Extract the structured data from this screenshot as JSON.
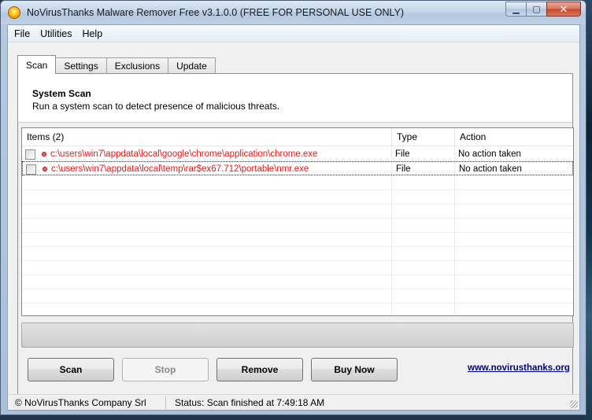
{
  "window": {
    "title": "NoVirusThanks Malware Remover Free v3.1.0.0 (FREE FOR PERSONAL USE ONLY)",
    "min_glyph": "▁",
    "max_glyph": "▢",
    "close_glyph": "✕"
  },
  "menu": {
    "items": [
      "File",
      "Utilities",
      "Help"
    ]
  },
  "tabs": {
    "items": [
      "Scan",
      "Settings",
      "Exclusions",
      "Update"
    ],
    "active": "Scan"
  },
  "panel": {
    "title": "System Scan",
    "subtitle": "Run a system scan to detect presence of malicious threats."
  },
  "list": {
    "columns": [
      "Items (2)",
      "Type",
      "Action"
    ],
    "rows": [
      {
        "path": "c:\\users\\win7\\appdata\\local\\google\\chrome\\application\\chrome.exe",
        "type": "File",
        "action": "No action taken",
        "checked": false
      },
      {
        "path": "c:\\users\\win7\\appdata\\local\\temp\\rar$ex67.712\\portable\\nmr.exe",
        "type": "File",
        "action": "No action taken",
        "checked": false
      }
    ]
  },
  "buttons": {
    "scan": "Scan",
    "stop": "Stop",
    "remove": "Remove",
    "buy_now": "Buy Now"
  },
  "link": "www.novirusthanks.org",
  "status": {
    "company": "© NoVirusThanks Company Srl",
    "text": "Status:  Scan finished at 7:49:18 AM"
  },
  "colors": {
    "threat_text": "#e21a1a",
    "link": "#000080"
  }
}
